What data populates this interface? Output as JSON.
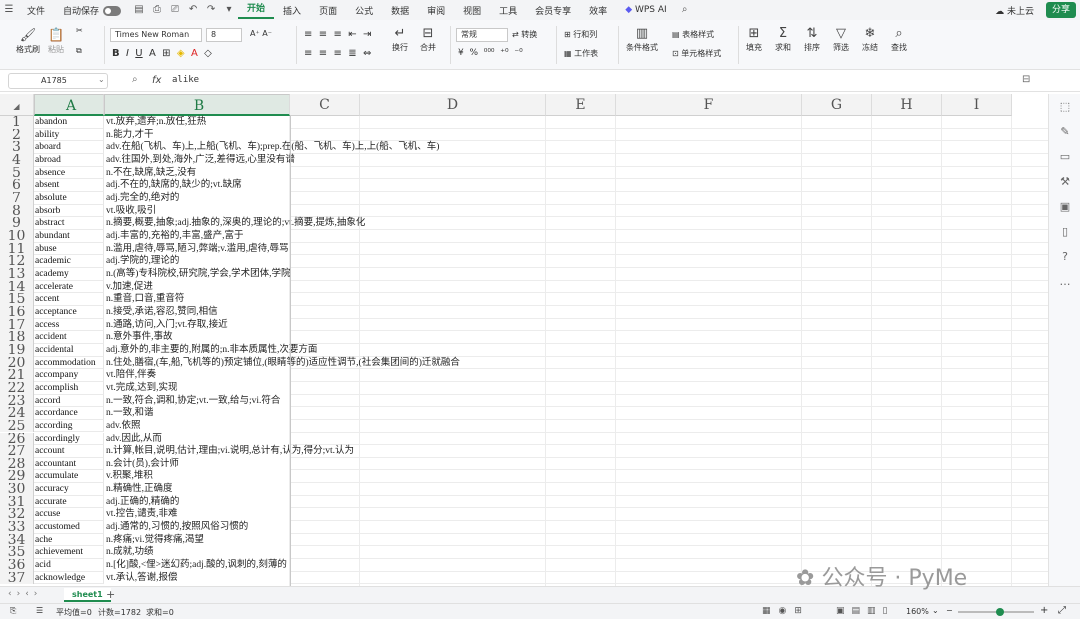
{
  "menu": {
    "file": "文件",
    "autosave": "自动保存",
    "tabs": [
      "开始",
      "插入",
      "页面",
      "公式",
      "数据",
      "审阅",
      "视图",
      "工具",
      "会员专享",
      "效率"
    ],
    "active_tab": "开始",
    "wps_ai": "WPS AI",
    "cloud": "未上云",
    "share": "分享"
  },
  "ribbon": {
    "format_painter": "格式刷",
    "paste": "粘贴",
    "font": "Times New Roman",
    "size": "8",
    "number_format": "常规",
    "convert": "转换",
    "wrap": "换行",
    "merge": "合并",
    "row_col": "行和列",
    "sheet": "工作表",
    "cond_format": "条件格式",
    "table_style": "表格样式",
    "cell_style": "单元格样式",
    "fill": "填充",
    "sum": "求和",
    "sort": "排序",
    "filter": "筛选",
    "freeze": "冻结",
    "find": "查找"
  },
  "formula_bar": {
    "name_box": "A1785",
    "value": "alike"
  },
  "columns": [
    "A",
    "B",
    "C",
    "D",
    "E",
    "F",
    "G",
    "H",
    "I"
  ],
  "rows": [
    {
      "n": "1",
      "a": "abandon",
      "b": "vt.放弃,遗弃;n.放任,狂热"
    },
    {
      "n": "2",
      "a": "ability",
      "b": "n.能力,才干"
    },
    {
      "n": "3",
      "a": "aboard",
      "b": "adv.在船(飞机、车)上,上船(飞机、车);prep.在(船、飞机、车)上,上(船、飞机、车)"
    },
    {
      "n": "4",
      "a": "abroad",
      "b": "adv.往国外,到处,海外,广泛,差得远,心里没有谱"
    },
    {
      "n": "5",
      "a": "absence",
      "b": "n.不在,缺席,缺乏,没有"
    },
    {
      "n": "6",
      "a": "absent",
      "b": "adj.不在的,缺席的,缺少的;vt.缺席"
    },
    {
      "n": "7",
      "a": "absolute",
      "b": "adj.完全的,绝对的"
    },
    {
      "n": "8",
      "a": "absorb",
      "b": "vt.吸收,吸引"
    },
    {
      "n": "9",
      "a": "abstract",
      "b": "n.摘要,概要,抽象;adj.抽象的,深奥的,理论的;vt.摘要,提炼,抽象化"
    },
    {
      "n": "10",
      "a": "abundant",
      "b": "adj.丰富的,充裕的,丰富,盛产,富于"
    },
    {
      "n": "11",
      "a": "abuse",
      "b": "n.滥用,虐待,辱骂,陋习,弊端;v.滥用,虐待,辱骂"
    },
    {
      "n": "12",
      "a": "academic",
      "b": "adj.学院的,理论的"
    },
    {
      "n": "13",
      "a": "academy",
      "b": "n.(高等)专科院校,研究院,学会,学术团体,学院"
    },
    {
      "n": "14",
      "a": "accelerate",
      "b": "v.加速,促进"
    },
    {
      "n": "15",
      "a": "accent",
      "b": "n.重音,口音,重音符"
    },
    {
      "n": "16",
      "a": "acceptance",
      "b": "n.接受,承诺,容忍,赞同,相信"
    },
    {
      "n": "17",
      "a": "access",
      "b": "n.通路,访问,入门;vt.存取,接近"
    },
    {
      "n": "18",
      "a": "accident",
      "b": "n.意外事件,事故"
    },
    {
      "n": "19",
      "a": "accidental",
      "b": "adj.意外的,非主要的,附属的;n.非本质属性,次要方面"
    },
    {
      "n": "20",
      "a": "accommodation",
      "b": "n.住处,膳宿,(车,船,飞机等的)预定铺位,(眼睛等的)适应性调节,(社会集团间的)迁就融合"
    },
    {
      "n": "21",
      "a": "accompany",
      "b": "vt.陪伴,伴奏"
    },
    {
      "n": "22",
      "a": "accomplish",
      "b": "vt.完成,达到,实现"
    },
    {
      "n": "23",
      "a": "accord",
      "b": "n.一致,符合,调和,协定;vt.一致,给与;vi.符合"
    },
    {
      "n": "24",
      "a": "accordance",
      "b": "n.一致,和谐"
    },
    {
      "n": "25",
      "a": "according",
      "b": "adv.依照"
    },
    {
      "n": "26",
      "a": "accordingly",
      "b": "adv.因此,从而"
    },
    {
      "n": "27",
      "a": "account",
      "b": "n.计算,帐目,说明,估计,理由;vi.说明,总计有,认为,得分;vt.认为"
    },
    {
      "n": "28",
      "a": "accountant",
      "b": "n.会计(员),会计师"
    },
    {
      "n": "29",
      "a": "accumulate",
      "b": "v.积聚,堆积"
    },
    {
      "n": "30",
      "a": "accuracy",
      "b": "n.精确性,正确度"
    },
    {
      "n": "31",
      "a": "accurate",
      "b": "adj.正确的,精确的"
    },
    {
      "n": "32",
      "a": "accuse",
      "b": "vt.控告,谴责,非难"
    },
    {
      "n": "33",
      "a": "accustomed",
      "b": "adj.通常的,习惯的,按照风俗习惯的"
    },
    {
      "n": "34",
      "a": "ache",
      "b": "n.疼痛;vi.觉得疼痛,渴望"
    },
    {
      "n": "35",
      "a": "achievement",
      "b": "n.成就,功绩"
    },
    {
      "n": "36",
      "a": "acid",
      "b": "n.[化]酸,<俚>迷幻药;adj.酸的,讽刺的,刻薄的"
    },
    {
      "n": "37",
      "a": "acknowledge",
      "b": "vt.承认,答谢,报偿"
    }
  ],
  "sheet_tab": "sheet1",
  "status": {
    "avg": "平均值=0",
    "count": "计数=1782",
    "sum": "求和=0",
    "zoom": "160%"
  },
  "watermark": "公众号 · PyMe"
}
